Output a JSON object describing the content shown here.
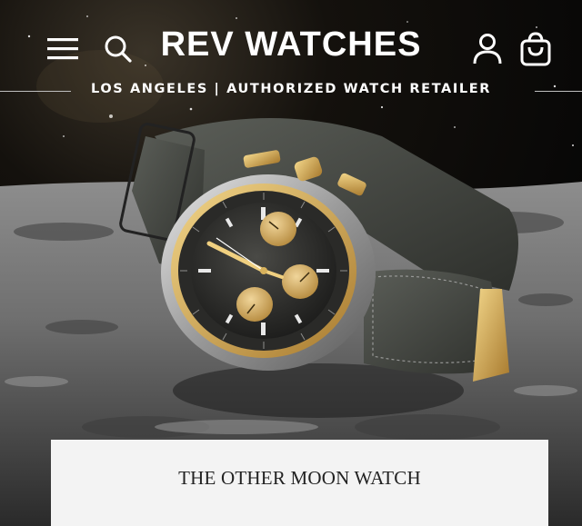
{
  "header": {
    "brand": "REV WATCHES",
    "tagline": "LOS ANGELES | AUTHORIZED WATCH RETAILER",
    "menu_icon": "hamburger-menu-icon",
    "search_icon": "search-icon",
    "account_icon": "user-account-icon",
    "cart_icon": "shopping-bag-icon"
  },
  "hero": {
    "image": "chronograph-watch-on-moon-surface",
    "card_title": "THE OTHER MOON WATCH"
  },
  "colors": {
    "text_light": "#ffffff",
    "card_bg": "#f3f3f3",
    "card_text": "#222222",
    "gold": "#c9a24a"
  }
}
